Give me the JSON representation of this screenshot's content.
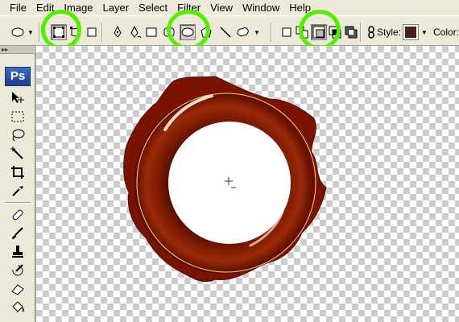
{
  "menu": {
    "items": [
      "File",
      "Edit",
      "Image",
      "Layer",
      "Select",
      "Filter",
      "View",
      "Window",
      "Help"
    ]
  },
  "options_bar": {
    "style_label": "Style:",
    "color_label": "Color:",
    "style_swatch_color": "#4a2018"
  },
  "toolbox": {
    "logo": "Ps"
  },
  "colors": {
    "highlight": "#50f000",
    "artwork": "#7a1400"
  }
}
